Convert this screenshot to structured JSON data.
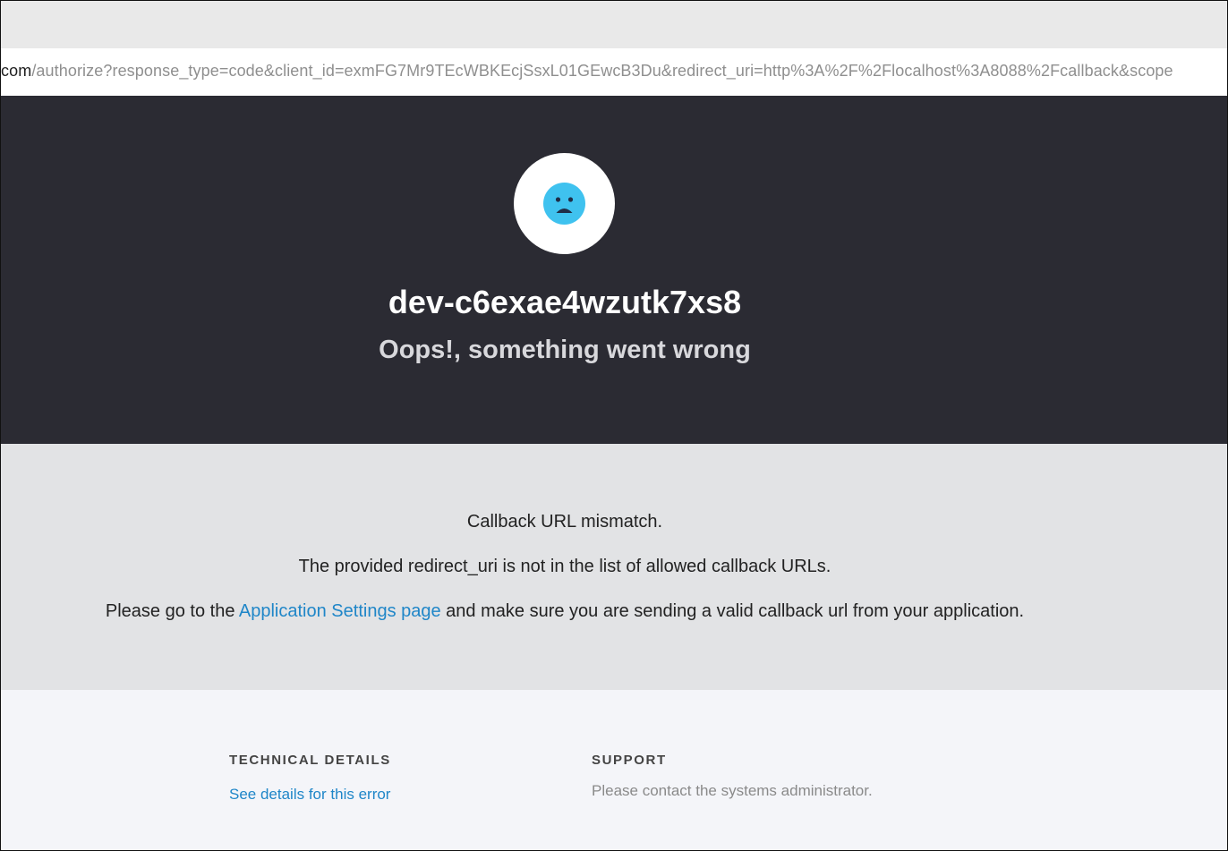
{
  "browser": {
    "url_host_fragment": "com",
    "url_path": "/authorize?response_type=code&client_id=exmFG7Mr9TEcWBKEcjSsxL01GEwcB3Du&redirect_uri=http%3A%2F%2Flocalhost%3A8088%2Fcallback&scope"
  },
  "hero": {
    "icon": "sad-face-icon",
    "tenant_name": "dev-c6exae4wzutk7xs8",
    "title": "Oops!, something went wrong"
  },
  "message": {
    "line1": "Callback URL mismatch.",
    "line2": "The provided redirect_uri is not in the list of allowed callback URLs.",
    "line3_prefix": "Please go to the ",
    "line3_link": "Application Settings page",
    "line3_suffix": " and make sure you are sending a valid callback url from your application."
  },
  "footer": {
    "technical_title": "TECHNICAL DETAILS",
    "technical_link": "See details for this error",
    "support_title": "SUPPORT",
    "support_text": "Please contact the systems administrator."
  },
  "colors": {
    "hero_bg": "#2b2b33",
    "message_bg": "#e2e3e5",
    "footer_bg": "#f4f5f9",
    "accent": "#1f86c8",
    "face": "#3fc2ef"
  }
}
